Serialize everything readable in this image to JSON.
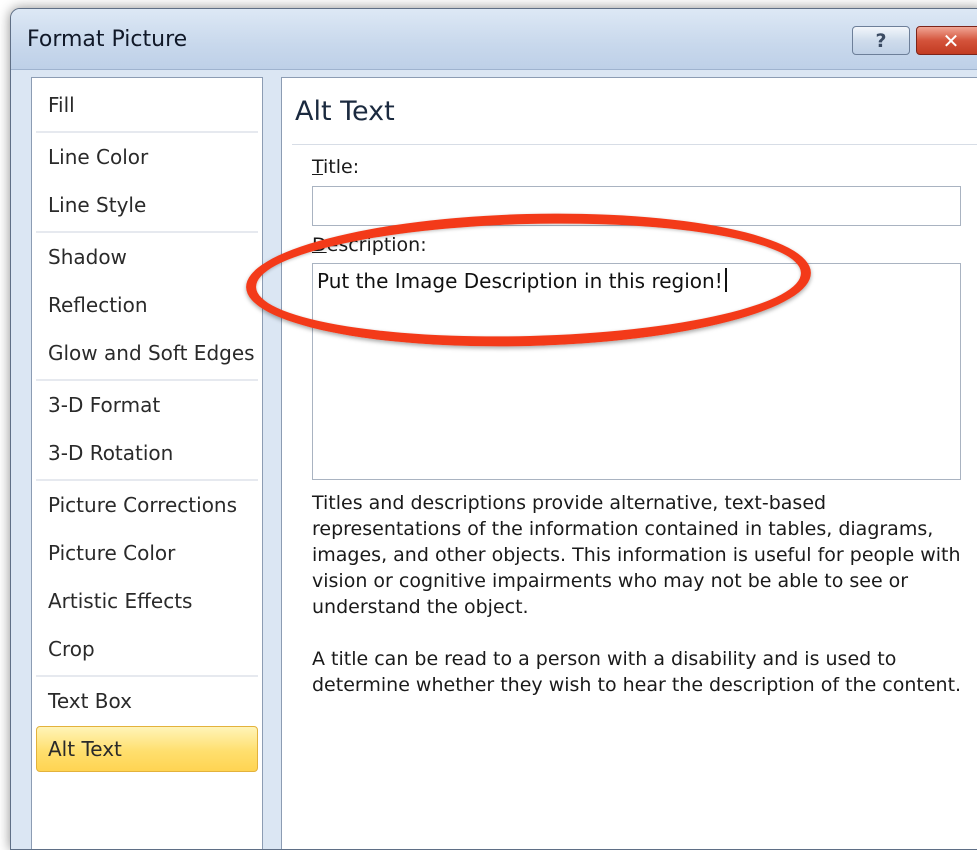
{
  "window": {
    "title": "Format Picture",
    "help_label": "?",
    "close_label": "✕"
  },
  "sidebar": {
    "items": [
      {
        "label": "Fill"
      },
      {
        "label": "Line Color"
      },
      {
        "label": "Line Style"
      },
      {
        "label": "Shadow"
      },
      {
        "label": "Reflection"
      },
      {
        "label": "Glow and Soft Edges"
      },
      {
        "label": "3-D Format"
      },
      {
        "label": "3-D Rotation"
      },
      {
        "label": "Picture Corrections"
      },
      {
        "label": "Picture Color"
      },
      {
        "label": "Artistic Effects"
      },
      {
        "label": "Crop"
      },
      {
        "label": "Text Box"
      },
      {
        "label": "Alt Text"
      }
    ],
    "selected": "Alt Text"
  },
  "panel": {
    "heading": "Alt Text",
    "title_label_first": "T",
    "title_label_rest": "itle:",
    "title_value": "",
    "description_label_first": "D",
    "description_label_rest": "escription:",
    "description_value": "Put the Image Description in this region!",
    "help_paragraph_1": "Titles and descriptions provide alternative, text-based representations of the information contained in tables, diagrams, images, and other objects. This information is useful for people with vision or cognitive impairments who may not be able to see or understand the object.",
    "help_paragraph_2": "A title can be read to a person with a disability and is used to determine whether they wish to hear the description of the content."
  },
  "colors": {
    "annotation": "#f33a19",
    "selected_item": "#ffdf6e",
    "titlebar": "#c8d8ec"
  },
  "icons": {
    "help": "help-icon",
    "close": "close-icon"
  }
}
